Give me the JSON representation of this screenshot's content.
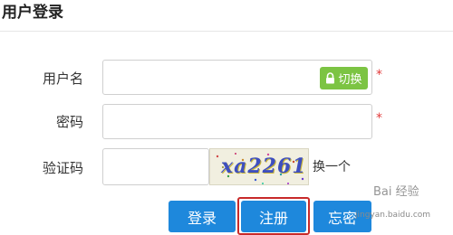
{
  "page": {
    "title": "用户登录"
  },
  "form": {
    "username_label": "用户名",
    "password_label": "密码",
    "captcha_label": "验证码",
    "required_mark": "*",
    "switch_label": "切换",
    "captcha_text": "xa2261",
    "refresh_captcha": "换一个"
  },
  "buttons": {
    "login": "登录",
    "register": "注册",
    "forgot": "忘密"
  },
  "watermark": {
    "brand": "Bai 经验",
    "url": "jingyan.baidu.com"
  },
  "colors": {
    "primary": "#1e88dc",
    "switch": "#7cc443",
    "required": "#e23b3b",
    "highlight": "#c82a2a"
  },
  "icons": {
    "switch": "lock-icon"
  }
}
